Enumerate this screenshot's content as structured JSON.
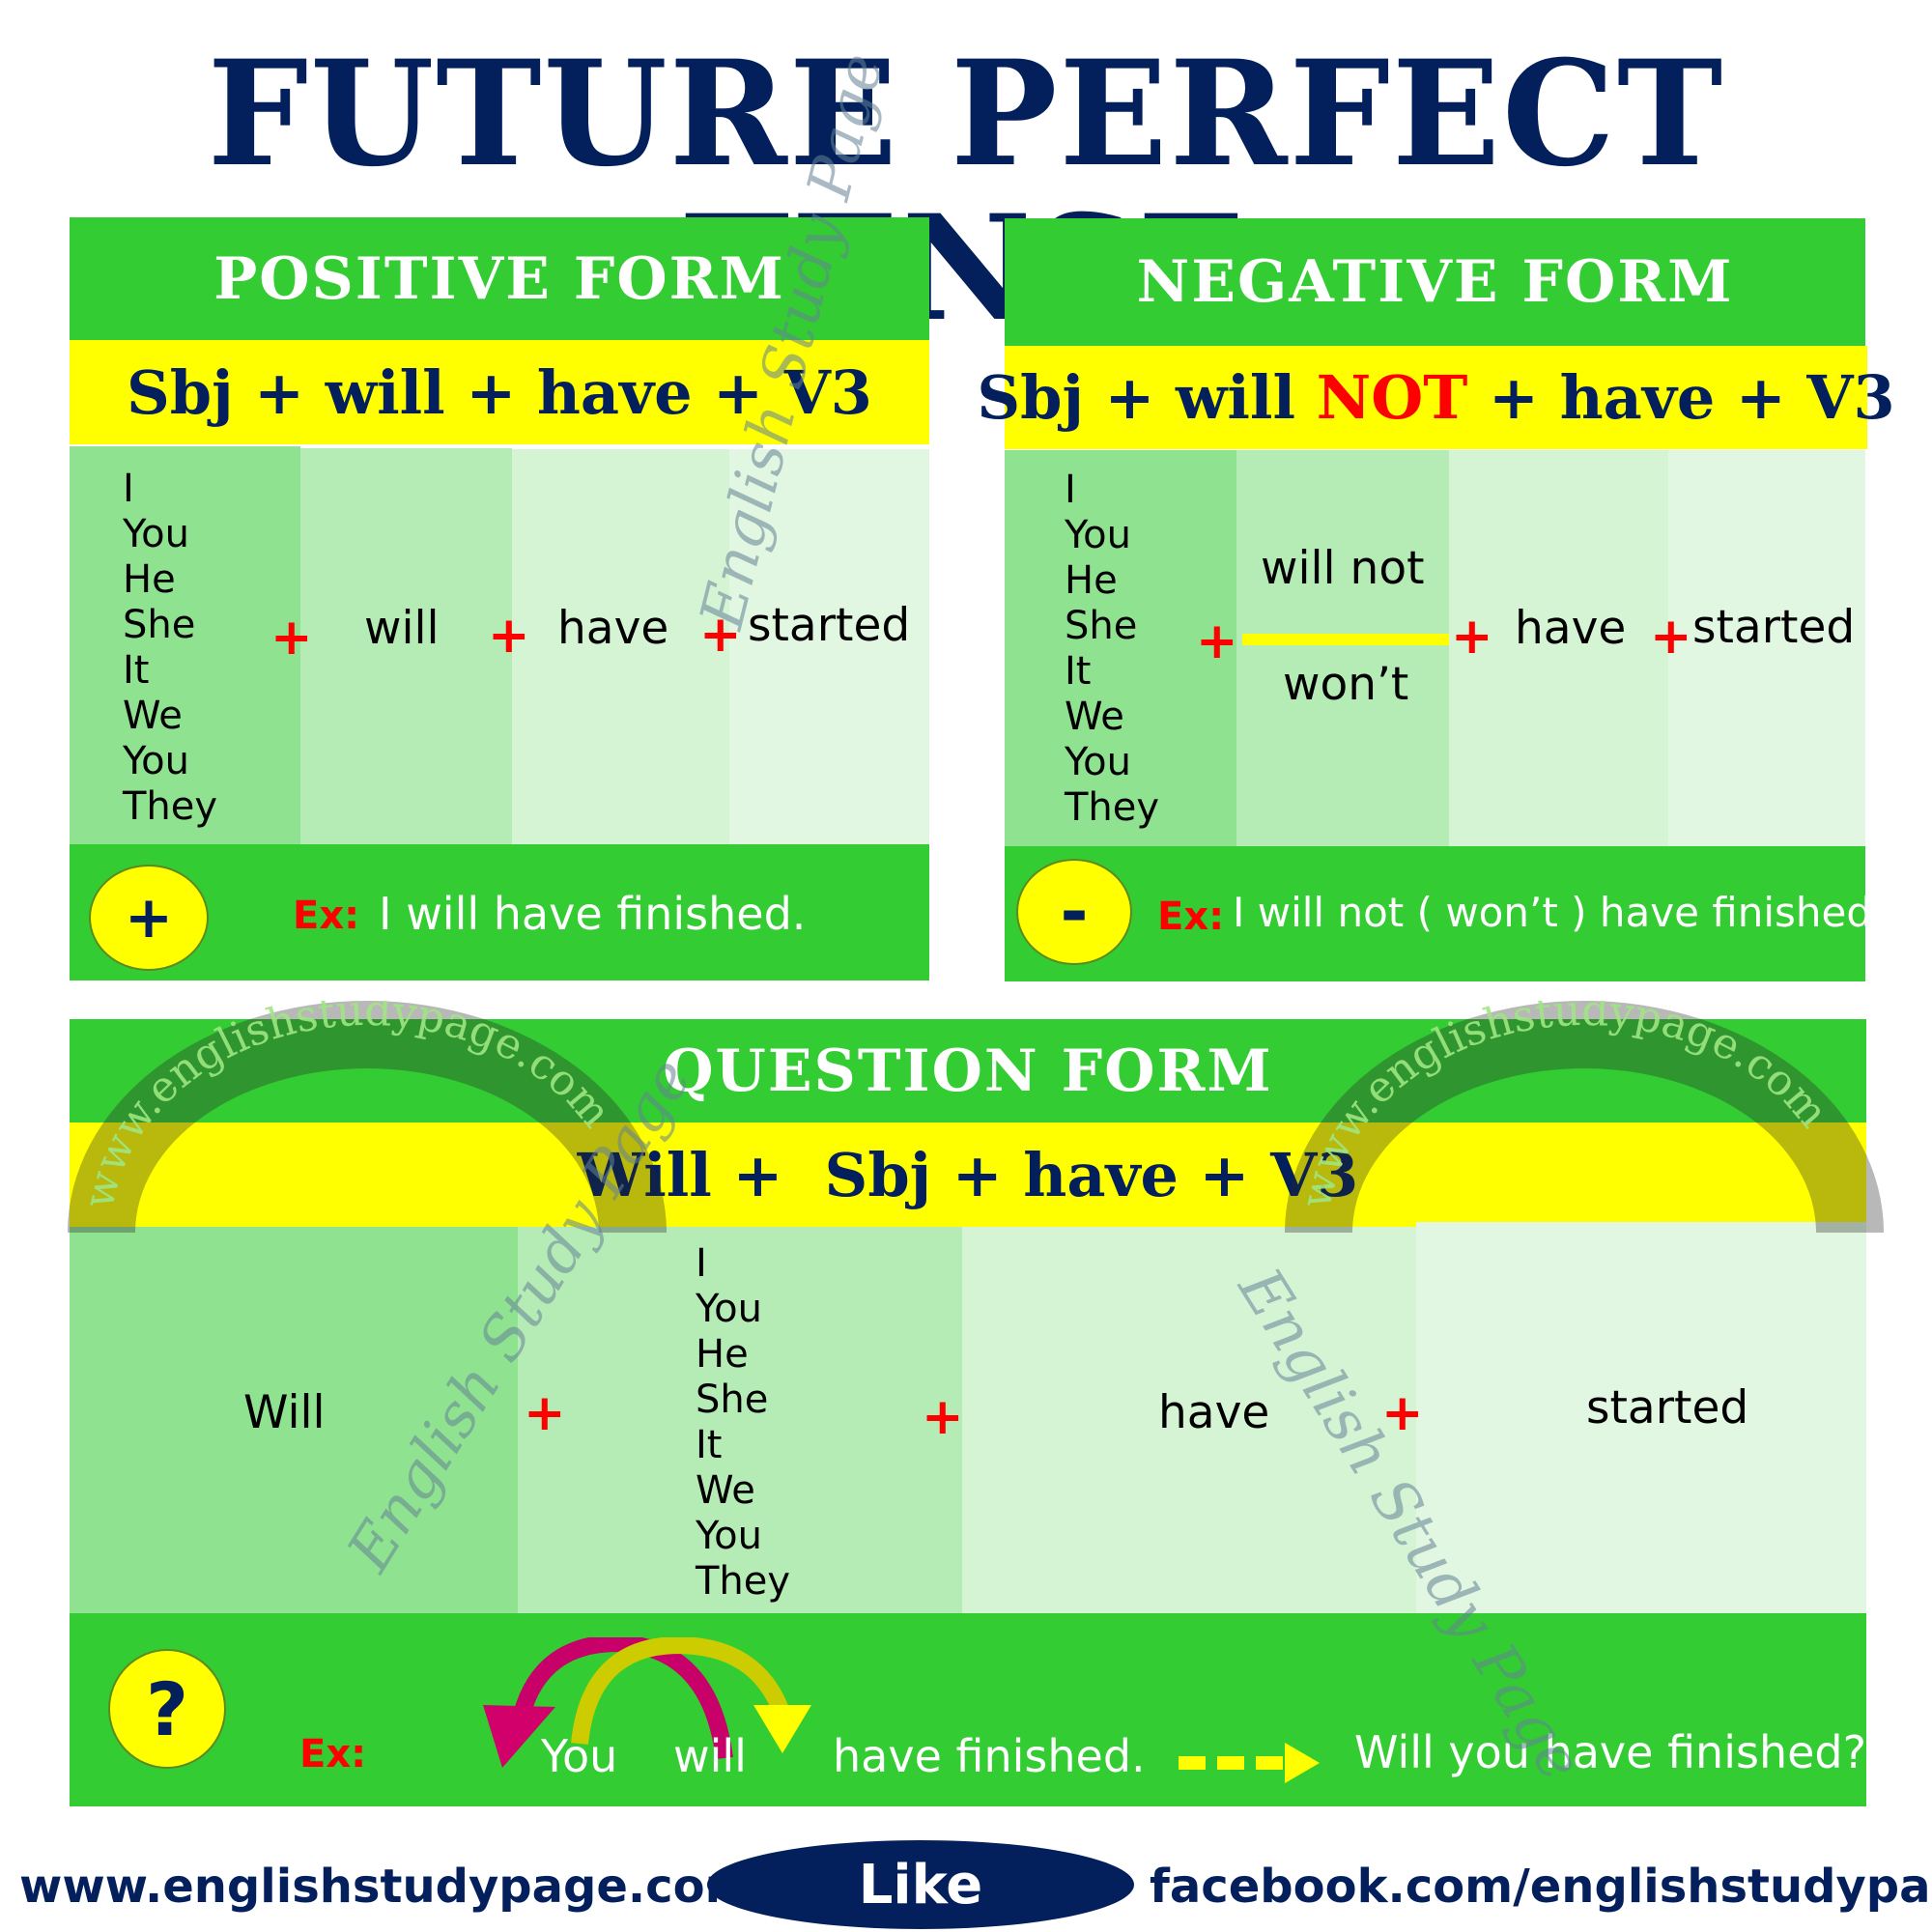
{
  "title": "FUTURE PERFECT TENSE",
  "colors": {
    "navy": "#03205c",
    "green": "#33cc33",
    "yellow": "#ffff00",
    "red": "#ff0000",
    "column_shades": [
      "#8fe28f",
      "#b5ecb5",
      "#d4f4d4",
      "#e1f7e1"
    ]
  },
  "subjects": [
    "I",
    "You",
    "He",
    "She",
    "It",
    "We",
    "You",
    "They"
  ],
  "positive": {
    "heading": "POSITIVE FORM",
    "formula": "Sbj + will + have + V3",
    "columns": [
      "will",
      "have",
      "started"
    ],
    "plus": "+",
    "example_icon": "plus-icon",
    "example_symbol": "+",
    "example_label": "Ex:",
    "example": "I will have finished."
  },
  "negative": {
    "heading": "NEGATIVE FORM",
    "formula_pre": "Sbj + will ",
    "formula_neg": "NOT",
    "formula_post": " + have + V3",
    "aux_full": "will not",
    "aux_short": "won’t",
    "columns": [
      "have",
      "started"
    ],
    "plus": "+",
    "example_icon": "minus-icon",
    "example_symbol": "-",
    "example_label": "Ex:",
    "example": "I will not ( won’t ) have finished."
  },
  "question": {
    "heading": "QUESTION FORM",
    "formula": "Will +  Sbj + have + V3",
    "first_column": "Will",
    "columns": [
      "have",
      "started"
    ],
    "plus": "+",
    "example_icon": "question-mark-icon",
    "example_symbol": "?",
    "example_label": "Ex:",
    "example_word1": "You",
    "example_word2": "will",
    "example_rest": "have finished.",
    "example_arrow_icon": "dashed-arrow-right-icon",
    "example_result": "Will you have finished?"
  },
  "watermarks": {
    "diagonal": "English Study Page",
    "arc": "www.englishstudypage.com"
  },
  "footer": {
    "website": "www.englishstudypage.com",
    "like_label": "Like",
    "facebook": "facebook.com/englishstudypage"
  }
}
